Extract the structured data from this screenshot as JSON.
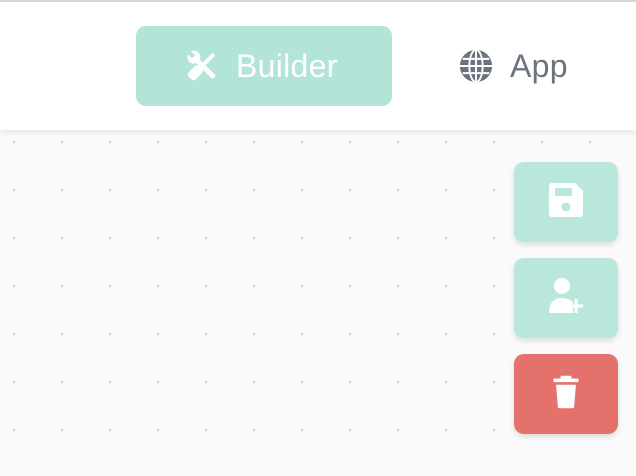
{
  "header": {
    "tabs": [
      {
        "label": "Builder",
        "icon": "tools-icon",
        "active": true
      },
      {
        "label": "App",
        "icon": "globe-icon",
        "active": false
      }
    ]
  },
  "actions": [
    {
      "name": "save",
      "icon": "floppy-disk-icon",
      "color": "#b9e7dc"
    },
    {
      "name": "add-user",
      "icon": "user-plus-icon",
      "color": "#b9e7dc"
    },
    {
      "name": "delete",
      "icon": "trash-icon",
      "color": "#e5716c"
    }
  ],
  "colors": {
    "accent": "#b2e4d8",
    "danger": "#e5716c",
    "muted_text": "#6b7280",
    "canvas": "#fafafa"
  }
}
